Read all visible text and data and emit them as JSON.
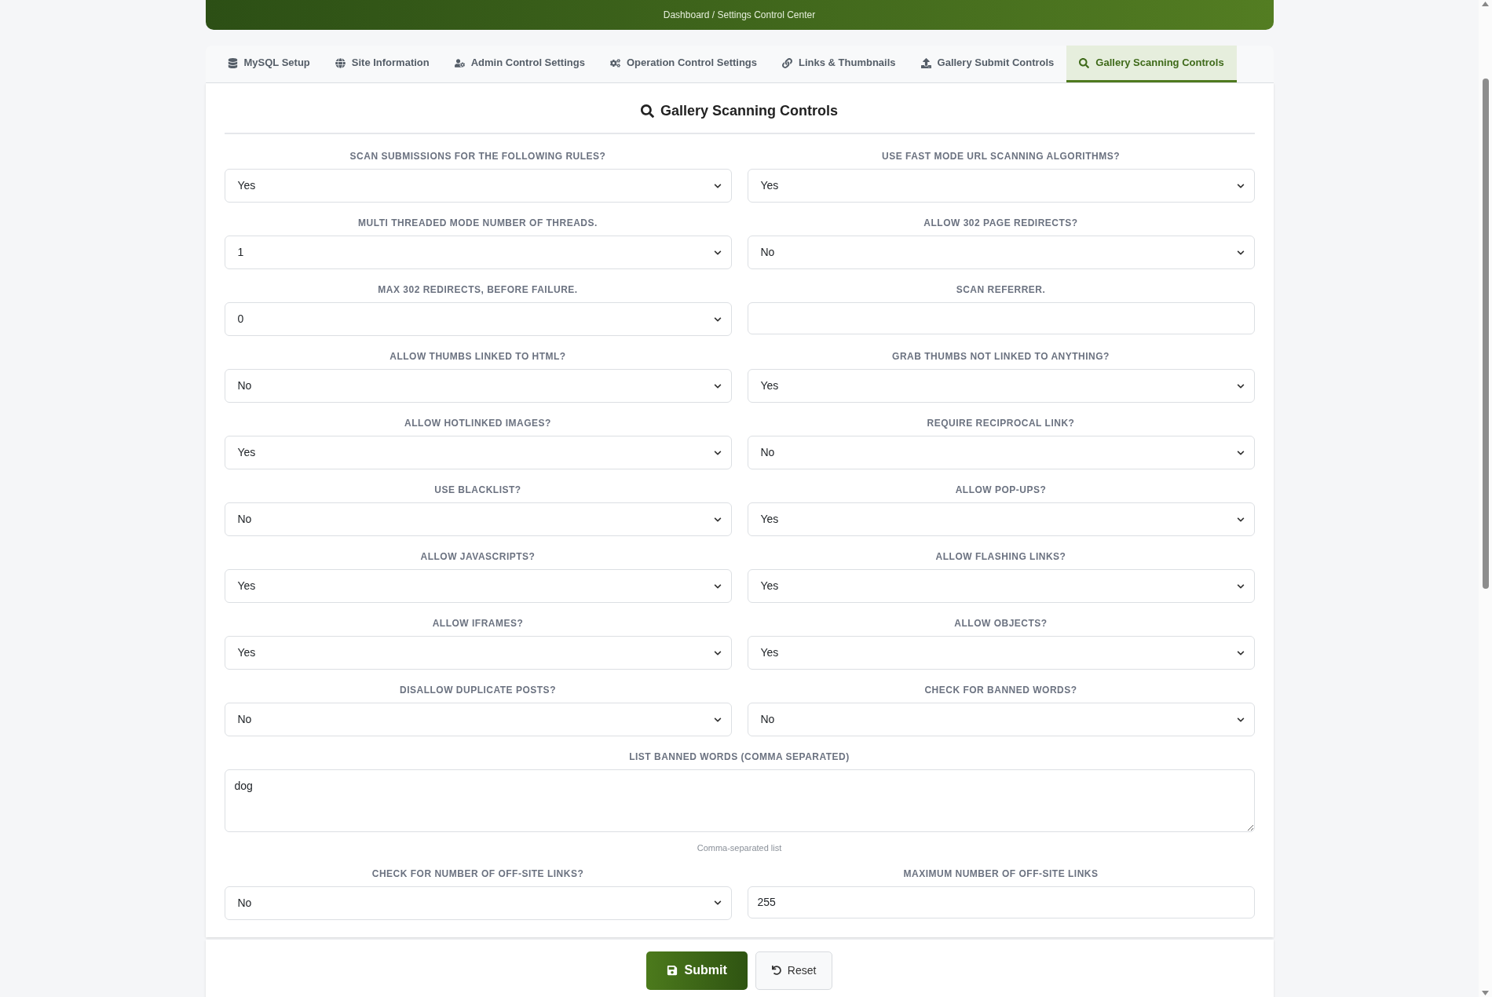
{
  "header": {
    "breadcrumb": "Dashboard / Settings Control Center"
  },
  "tabs": [
    {
      "label": "MySQL Setup",
      "selected": false
    },
    {
      "label": "Site Information",
      "selected": false
    },
    {
      "label": "Admin Control Settings",
      "selected": false
    },
    {
      "label": "Operation Control Settings",
      "selected": false
    },
    {
      "label": "Links & Thumbnails",
      "selected": false
    },
    {
      "label": "Gallery Submit Controls",
      "selected": false
    },
    {
      "label": "Gallery Scanning Controls",
      "selected": true
    }
  ],
  "section_title": "Gallery Scanning Controls",
  "fields": [
    {
      "kind": "select",
      "label": "SCAN SUBMISSIONS FOR THE FOLLOWING RULES?",
      "value": "Yes"
    },
    {
      "kind": "select",
      "label": "USE FAST MODE URL SCANNING ALGORITHMS?",
      "value": "Yes"
    },
    {
      "kind": "select",
      "label": "MULTI THREADED MODE NUMBER OF THREADS.",
      "value": "1"
    },
    {
      "kind": "select",
      "label": "ALLOW 302 PAGE REDIRECTS?",
      "value": "No"
    },
    {
      "kind": "select",
      "label": "MAX 302 REDIRECTS, BEFORE FAILURE.",
      "value": "0"
    },
    {
      "kind": "input",
      "label": "SCAN REFERRER."
    },
    {
      "kind": "select",
      "label": "ALLOW THUMBS LINKED TO HTML?",
      "value": "No"
    },
    {
      "kind": "select",
      "label": "GRAB THUMBS NOT LINKED TO ANYTHING?",
      "value": "Yes"
    },
    {
      "kind": "select",
      "label": "ALLOW HOTLINKED IMAGES?",
      "value": "Yes"
    },
    {
      "kind": "select",
      "label": "REQUIRE RECIPROCAL LINK?",
      "value": "No"
    },
    {
      "kind": "select",
      "label": "USE BLACKLIST?",
      "value": "No"
    },
    {
      "kind": "select",
      "label": "ALLOW POP-UPS?",
      "value": "Yes"
    },
    {
      "kind": "select",
      "label": "ALLOW JAVASCRIPTS?",
      "value": "Yes"
    },
    {
      "kind": "select",
      "label": "ALLOW FLASHING LINKS?",
      "value": "Yes"
    },
    {
      "kind": "select",
      "label": "ALLOW IFRAMES?",
      "value": "Yes"
    },
    {
      "kind": "select",
      "label": "ALLOW OBJECTS?",
      "value": "Yes"
    },
    {
      "kind": "select",
      "label": "DISALLOW DUPLICATE POSTS?",
      "value": "No"
    },
    {
      "kind": "select",
      "label": "CHECK FOR BANNED WORDS?",
      "value": "No"
    },
    {
      "kind": "textarea",
      "label": "LIST BANNED WORDS (COMMA SEPARATED)",
      "value": "dog",
      "hint": "Comma-separated list"
    },
    {
      "kind": "select",
      "label": "CHECK FOR NUMBER OF OFF-SITE LINKS?",
      "value": "No"
    },
    {
      "kind": "input",
      "label": "MAXIMUM NUMBER OF OFF-SITE LINKS",
      "value": "255"
    }
  ],
  "buttons": [
    {
      "kind": "primary",
      "label": "Submit"
    },
    {
      "kind": "secondary",
      "label": "Reset"
    }
  ]
}
